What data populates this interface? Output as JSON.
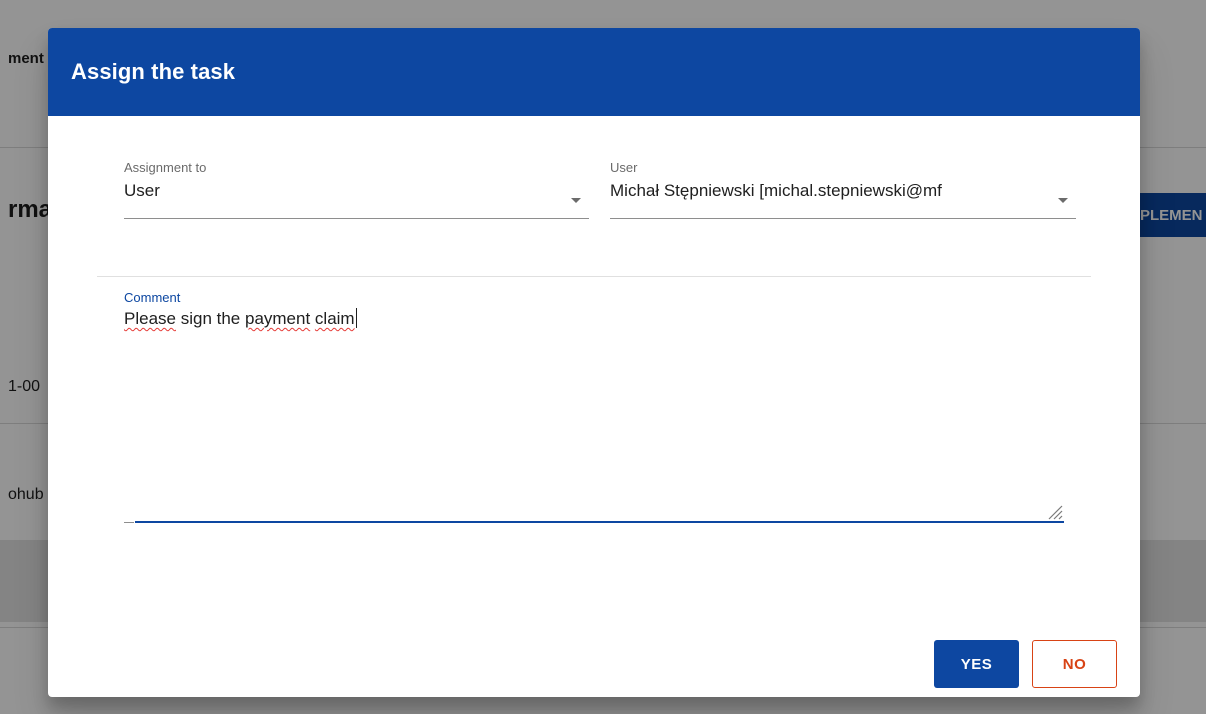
{
  "background": {
    "tab_fragment": "ment",
    "heading_fragment": "rma",
    "button_fragment": "PLEMEN",
    "date_fragment": "1-00",
    "user_fragment": "ohub"
  },
  "dialog": {
    "title": "Assign the task",
    "assignment": {
      "label": "Assignment to",
      "value": "User"
    },
    "user": {
      "label": "User",
      "value": "Michał Stępniewski [michal.stepniewski@mf"
    },
    "comment": {
      "label": "Comment",
      "words": [
        "Please",
        " sign the ",
        "payment",
        " ",
        "claim"
      ]
    },
    "buttons": {
      "yes": "YES",
      "no": "NO"
    }
  },
  "colors": {
    "primary": "#0d47a1",
    "danger": "#d84315",
    "spellcheck": "#e53935"
  },
  "icons": {
    "dropdown": "caret-down-icon",
    "resize": "resize-handle-icon"
  }
}
